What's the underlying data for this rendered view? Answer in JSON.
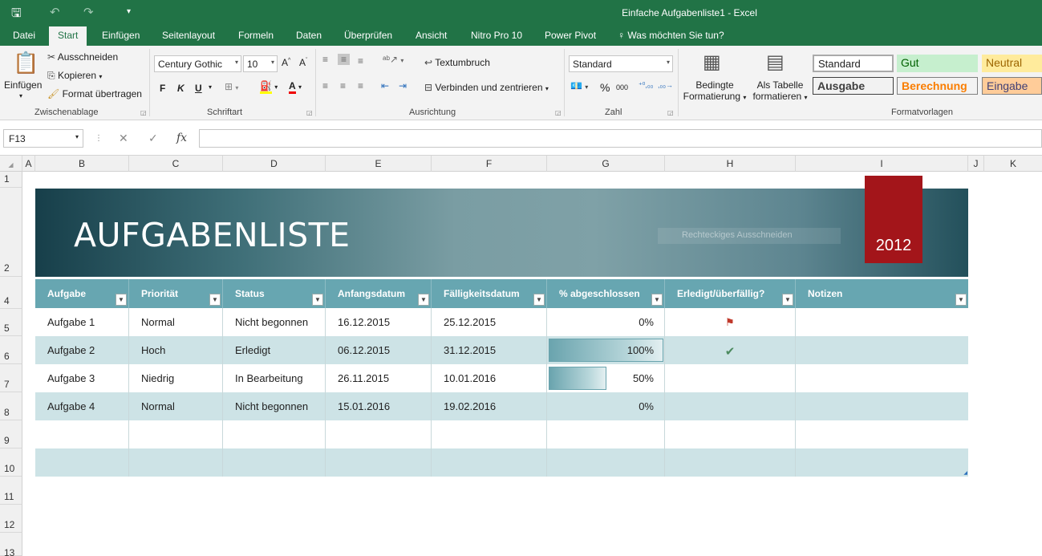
{
  "window": {
    "title": "Einfache Aufgabenliste1 - Excel"
  },
  "tabs": [
    "Datei",
    "Start",
    "Einfügen",
    "Seitenlayout",
    "Formeln",
    "Daten",
    "Überprüfen",
    "Ansicht",
    "Nitro Pro 10",
    "Power Pivot"
  ],
  "tell_me": "Was möchten Sie tun?",
  "ribbon": {
    "clipboard": {
      "paste": "Einfügen",
      "cut": "Ausschneiden",
      "copy": "Kopieren",
      "format_painter": "Format übertragen",
      "label": "Zwischenablage"
    },
    "font": {
      "name": "Century Gothic",
      "size": "10",
      "bold": "F",
      "italic": "K",
      "underline": "U",
      "label": "Schriftart"
    },
    "alignment": {
      "wrap": "Textumbruch",
      "merge": "Verbinden und zentrieren",
      "label": "Ausrichtung"
    },
    "number": {
      "format": "Standard",
      "percent": "%",
      "thousands": "000",
      "label": "Zahl"
    },
    "styles": {
      "conditional": [
        "Bedingte",
        "Formatierung"
      ],
      "as_table": [
        "Als Tabelle",
        "formatieren"
      ],
      "standard": "Standard",
      "gut": "Gut",
      "neutral": "Neutral",
      "ausgabe": "Ausgabe",
      "berechnung": "Berechnung",
      "eingabe": "Eingabe",
      "label": "Formatvorlagen"
    }
  },
  "formula_bar": {
    "name_box": "F13",
    "fx": "fx",
    "content": ""
  },
  "columns": [
    "A",
    "B",
    "C",
    "D",
    "E",
    "F",
    "G",
    "H",
    "I",
    "J",
    "K"
  ],
  "rows": [
    "1",
    "2",
    "4",
    "5",
    "6",
    "7",
    "8",
    "9",
    "10",
    "11",
    "12",
    "13"
  ],
  "banner": {
    "title": "AUFGABENLISTE",
    "year": "2012",
    "shape_tooltip": "Rechteckiges Ausschneiden"
  },
  "table": {
    "headers": [
      "Aufgabe",
      "Priorität",
      "Status",
      "Anfangsdatum",
      "Fälligkeitsdatum",
      "% abgeschlossen",
      "Erledigt/überfällig?",
      "Notizen"
    ],
    "rows": [
      {
        "task": "Aufgabe 1",
        "priority": "Normal",
        "status": "Nicht begonnen",
        "start": "16.12.2015",
        "due": "25.12.2015",
        "pct": "0%",
        "pct_value": 0,
        "flag": "overdue"
      },
      {
        "task": "Aufgabe 2",
        "priority": "Hoch",
        "status": "Erledigt",
        "start": "06.12.2015",
        "due": "31.12.2015",
        "pct": "100%",
        "pct_value": 100,
        "flag": "done"
      },
      {
        "task": "Aufgabe 3",
        "priority": "Niedrig",
        "status": "In Bearbeitung",
        "start": "26.11.2015",
        "due": "10.01.2016",
        "pct": "50%",
        "pct_value": 50,
        "flag": ""
      },
      {
        "task": "Aufgabe 4",
        "priority": "Normal",
        "status": "Nicht begonnen",
        "start": "15.01.2016",
        "due": "19.02.2016",
        "pct": "0%",
        "pct_value": 0,
        "flag": ""
      }
    ]
  },
  "colors": {
    "excel_green": "#217346",
    "table_header": "#67a6b1",
    "band": "#cde3e6",
    "year_box": "#a3151a"
  }
}
